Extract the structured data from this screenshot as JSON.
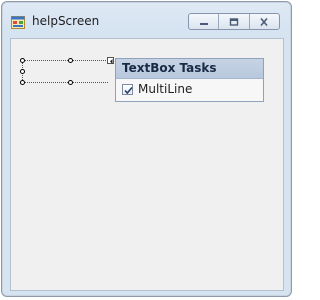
{
  "window": {
    "title": "helpScreen"
  },
  "title_controls": {
    "minimize_icon": "minimize-icon",
    "maximize_icon": "maximize-icon",
    "close_icon": "close-icon"
  },
  "smart_tag_panel": {
    "header": "TextBox Tasks",
    "options": [
      {
        "label": "MultiLine",
        "checked": true
      }
    ]
  }
}
